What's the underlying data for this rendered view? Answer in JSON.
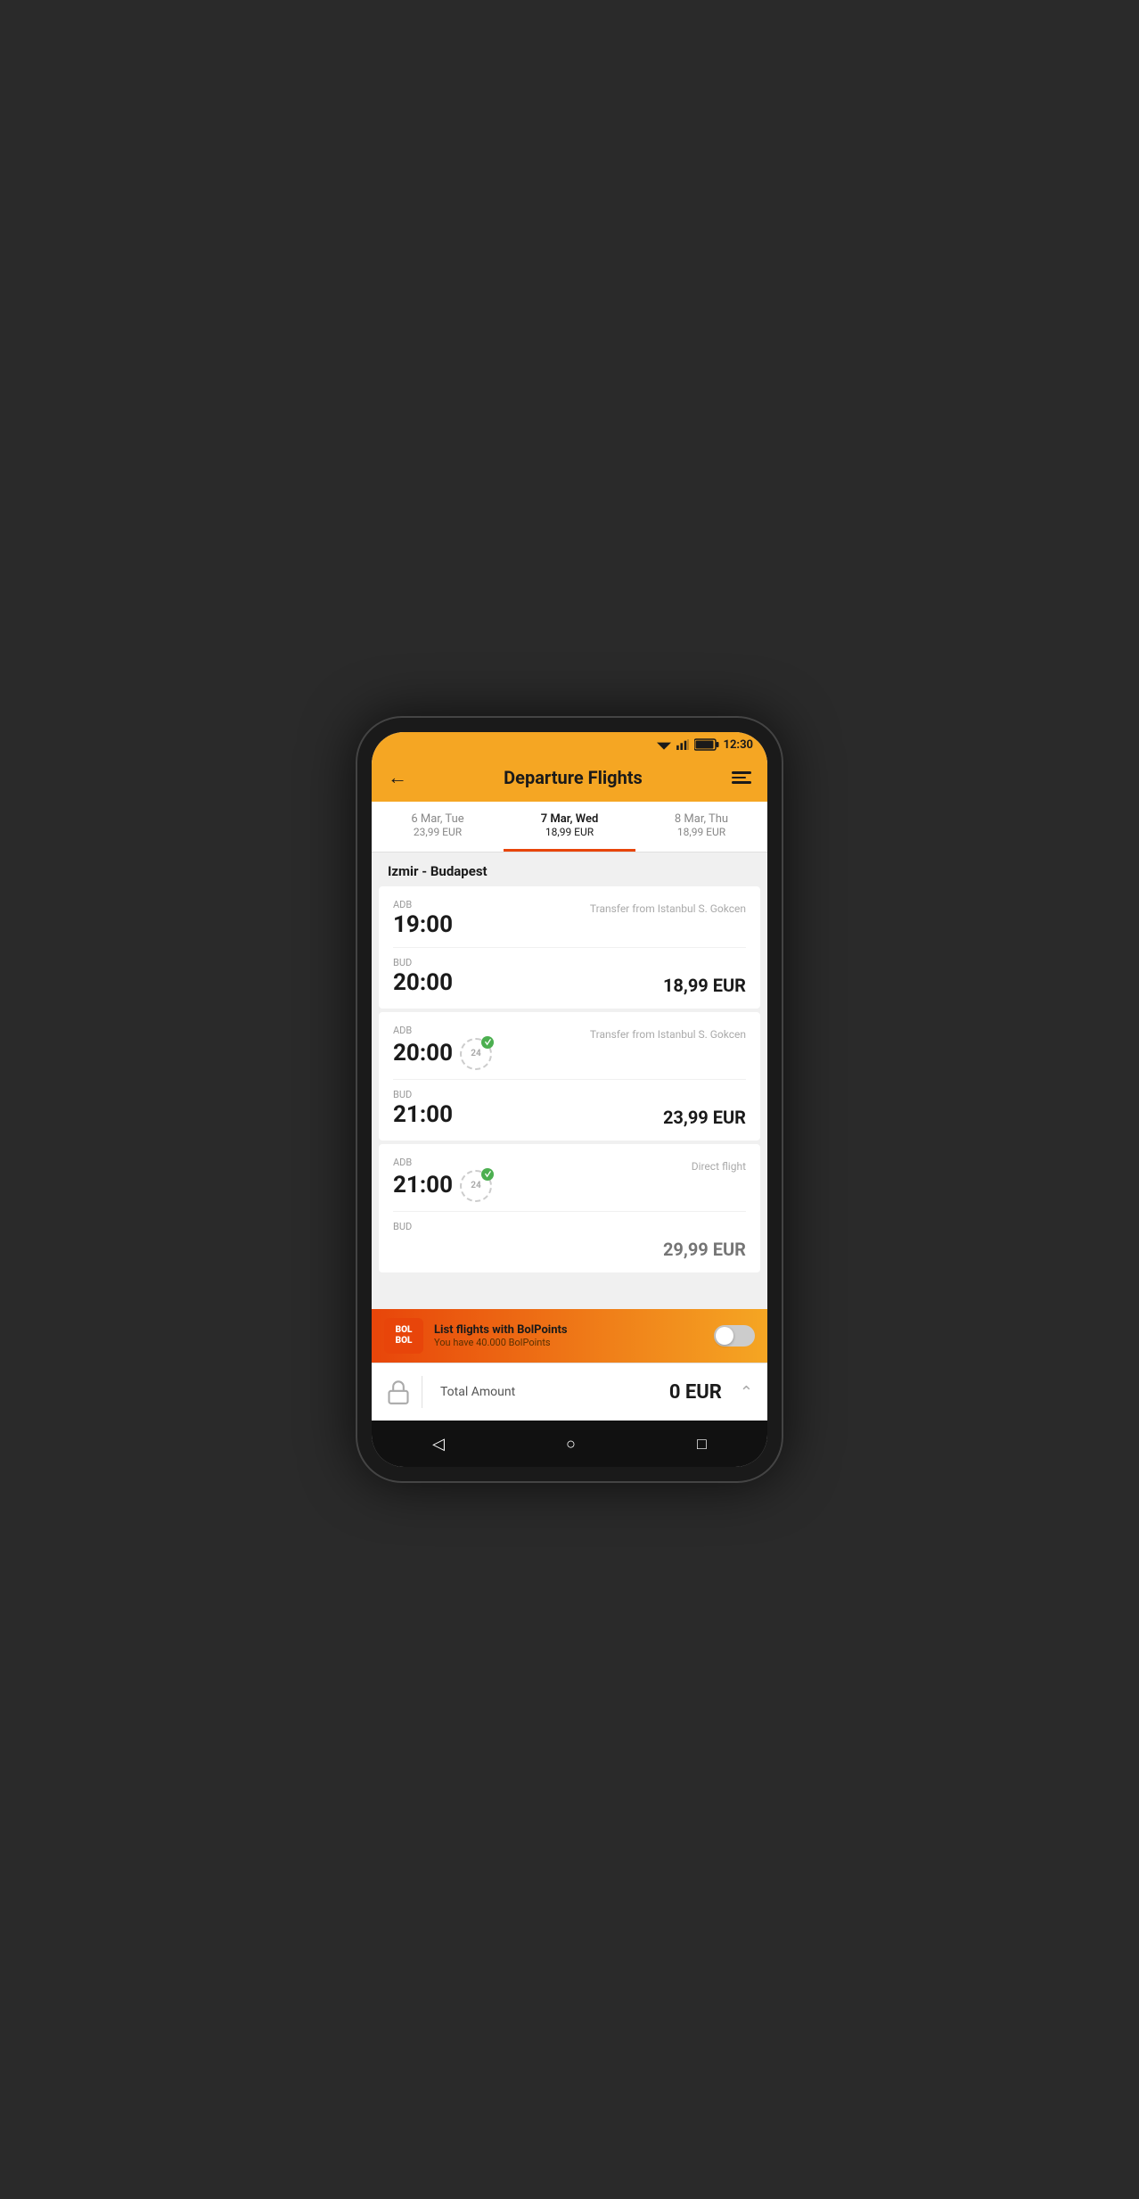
{
  "status": {
    "time": "12:30"
  },
  "header": {
    "back_label": "←",
    "title": "Departure Flights",
    "filter_label": "filter"
  },
  "date_tabs": [
    {
      "date": "6 Mar, Tue",
      "price": "23,99 EUR",
      "active": false
    },
    {
      "date": "7 Mar, Wed",
      "price": "18,99 EUR",
      "active": true
    },
    {
      "date": "8 Mar, Thu",
      "price": "18,99 EUR",
      "active": false
    }
  ],
  "route": "Izmir - Budapest",
  "flights": [
    {
      "dep_code": "ADB",
      "dep_time": "19:00",
      "arr_code": "BUD",
      "arr_time": "20:00",
      "transfer": "Transfer from Istanbul S. Gokcen",
      "price": "18,99 EUR",
      "has_badge": false,
      "direct": false
    },
    {
      "dep_code": "ADB",
      "dep_time": "20:00",
      "arr_code": "BUD",
      "arr_time": "21:00",
      "transfer": "Transfer from Istanbul S. Gokcen",
      "price": "23,99 EUR",
      "has_badge": true,
      "direct": false
    },
    {
      "dep_code": "ADB",
      "dep_time": "21:00",
      "arr_code": "BUD",
      "arr_time": "",
      "transfer": "Direct flight",
      "price": "29,99 EUR",
      "has_badge": true,
      "direct": true
    }
  ],
  "bolpoints": {
    "logo_line1": "BOL",
    "logo_line2": "BOL",
    "title": "List flights with BolPoints",
    "subtitle": "You have 40.000 BolPoints"
  },
  "total": {
    "label": "Total Amount",
    "amount": "0 EUR"
  },
  "nav": {
    "back": "◁",
    "home": "○",
    "recents": "□"
  }
}
